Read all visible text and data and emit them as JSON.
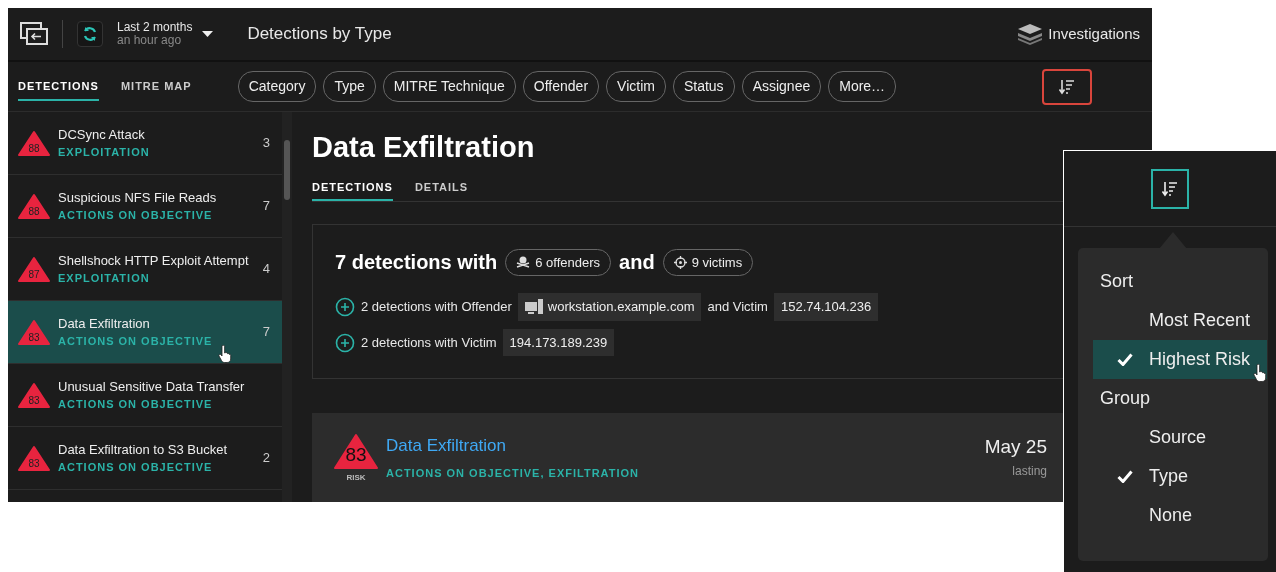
{
  "header": {
    "time_range": "Last 2 months",
    "updated": "an hour ago",
    "title": "Detections by Type",
    "investigations": "Investigations"
  },
  "view_tabs": [
    {
      "label": "DETECTIONS",
      "selected": true
    },
    {
      "label": "MITRE MAP",
      "selected": false
    }
  ],
  "filters": [
    "Category",
    "Type",
    "MITRE Technique",
    "Offender",
    "Victim",
    "Status",
    "Assignee",
    "More…"
  ],
  "detections": [
    {
      "risk": "88",
      "name": "DCSync Attack",
      "category": "EXPLOITATION",
      "count": "3",
      "selected": false
    },
    {
      "risk": "88",
      "name": "Suspicious NFS File Reads",
      "category": "ACTIONS ON OBJECTIVE",
      "count": "7",
      "selected": false
    },
    {
      "risk": "87",
      "name": "Shellshock HTTP Exploit Attempt",
      "category": "EXPLOITATION",
      "count": "4",
      "selected": false
    },
    {
      "risk": "83",
      "name": "Data Exfiltration",
      "category": "ACTIONS ON OBJECTIVE",
      "count": "7",
      "selected": true
    },
    {
      "risk": "83",
      "name": "Unusual Sensitive Data Transfer",
      "category": "ACTIONS ON OBJECTIVE",
      "selected": false
    },
    {
      "risk": "83",
      "name": "Data Exfiltration to S3 Bucket",
      "category": "ACTIONS ON OBJECTIVE",
      "count": "2",
      "selected": false
    }
  ],
  "detail": {
    "title": "Data Exfiltration",
    "tabs": [
      {
        "label": "DETECTIONS",
        "selected": true
      },
      {
        "label": "DETAILS",
        "selected": false
      }
    ],
    "summary": {
      "lead": "7 detections with",
      "offenders": "6 offenders",
      "joiner": "and",
      "victims": "9 victims"
    },
    "groups": [
      {
        "text": "2 detections with Offender",
        "offender": "workstation.example.com",
        "joiner": "and Victim",
        "victim": "152.74.104.236"
      },
      {
        "text": "2 detections with Victim",
        "victim": "194.173.189.239"
      }
    ],
    "detection": {
      "risk": "83",
      "risk_label": "RISK",
      "title": "Data Exfiltration",
      "categories": "ACTIONS ON OBJECTIVE, EXFILTRATION",
      "date": "May 25",
      "duration": "lasting"
    }
  },
  "sort_menu": {
    "sections": [
      {
        "heading": "Sort",
        "options": [
          {
            "label": "Most Recent",
            "checked": false,
            "selected": false
          },
          {
            "label": "Highest Risk",
            "checked": true,
            "selected": true
          }
        ]
      },
      {
        "heading": "Group",
        "options": [
          {
            "label": "Source",
            "checked": false,
            "selected": false
          },
          {
            "label": "Type",
            "checked": true,
            "selected": false
          },
          {
            "label": "None",
            "checked": false,
            "selected": false
          }
        ]
      }
    ]
  }
}
